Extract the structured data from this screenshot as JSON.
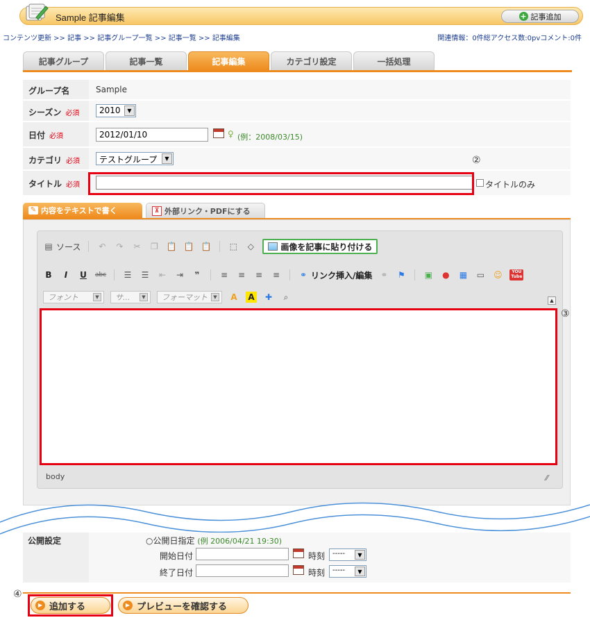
{
  "header": {
    "title": "Sample 記事編集",
    "add_button_label": "記事追加",
    "breadcrumb": "コンテンツ更新 >> 記事 >> 記事グループ一覧 >> 記事一覧 >> 記事編集",
    "stats": "関連情報：0件総アクセス数:0pvコメント:0件"
  },
  "tabs": [
    {
      "label": "記事グループ"
    },
    {
      "label": "記事一覧"
    },
    {
      "label": "記事編集",
      "active": true
    },
    {
      "label": "カテゴリ設定"
    },
    {
      "label": "一括処理"
    }
  ],
  "form": {
    "group_label": "グループ名",
    "group_value": "Sample",
    "required_mark": "必須",
    "season_label": "シーズン",
    "season_value": "2010",
    "date_label": "日付",
    "date_value": "2012/01/10",
    "date_example": "(例：2008/03/15)",
    "category_label": "カテゴリ",
    "category_value": "テストグループ",
    "title_label": "タイトル",
    "title_value": "",
    "title_only_label": "タイトルのみ"
  },
  "editor_tabs": {
    "text_tab": "内容をテキストで書く",
    "link_tab": "外部リンク・PDFにする"
  },
  "toolbar": {
    "source_label": "ソース",
    "paste_image_label": "画像を記事に貼り付ける",
    "link_label": "リンク挿入/編集",
    "font_combo": "フォント",
    "size_combo": "サ...",
    "format_combo": "フォーマット",
    "youtube_label": "YOU Tube"
  },
  "editor": {
    "status_path": "body"
  },
  "annotations": {
    "title_marker": "②",
    "editor_marker": "③",
    "submit_marker": "④"
  },
  "publish": {
    "label": "公開設定",
    "radio_label": "公開日指定",
    "example": "(例 2006/04/21 19:30)",
    "start_label": "開始日付",
    "end_label": "終了日付",
    "time_label": "時刻",
    "time_value": "-----"
  },
  "buttons": {
    "submit": "追加する",
    "preview": "プレビューを確認する"
  },
  "colors": {
    "accent_orange": "#ee8b1e",
    "highlight_red": "#e60012",
    "link_blue": "#1a3c8e",
    "wave_blue": "#4a90d9"
  }
}
